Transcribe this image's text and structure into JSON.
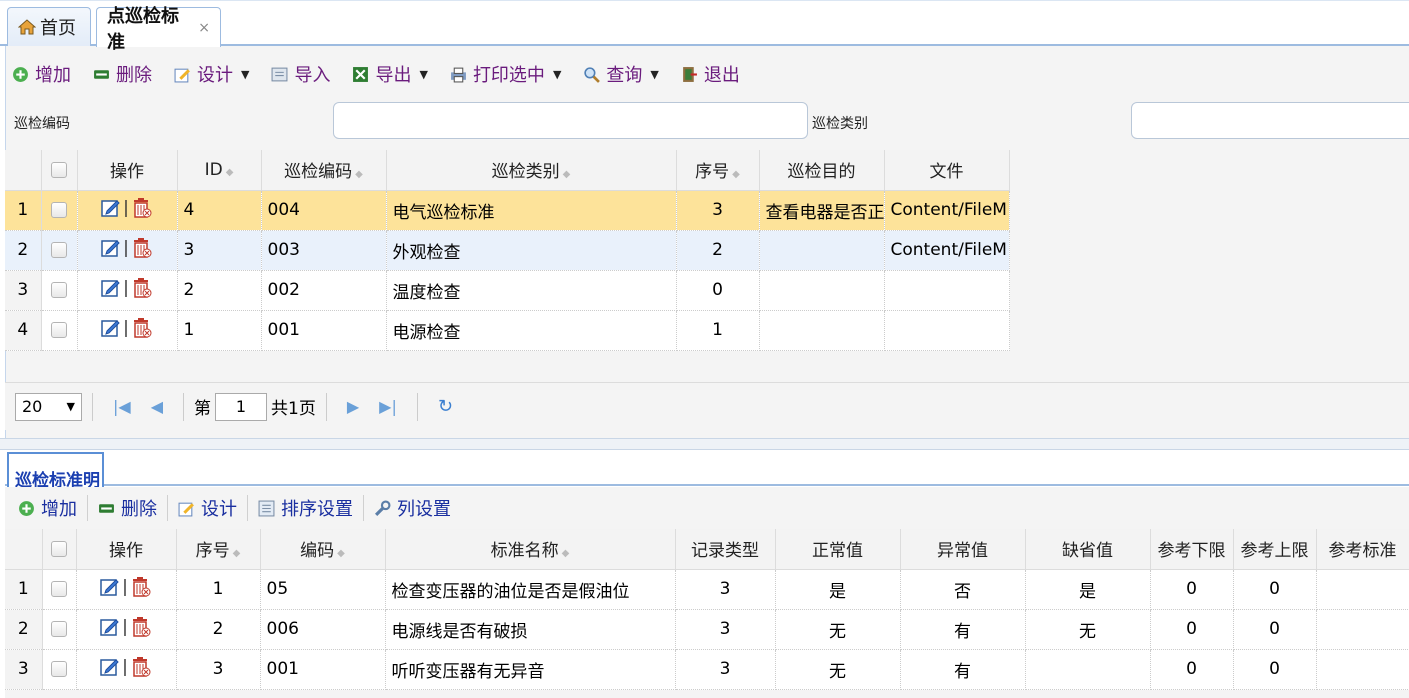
{
  "tabs": {
    "home": "首页",
    "active": "点巡检标准",
    "close": "×"
  },
  "toolbar": {
    "add": "增加",
    "delete": "删除",
    "design": "设计",
    "import": "导入",
    "export": "导出",
    "print": "打印选中",
    "query": "查询",
    "exit": "退出"
  },
  "filters": {
    "code_label": "巡检编码",
    "code_value": "",
    "type_label": "巡检类别",
    "type_value": ""
  },
  "grid1": {
    "headers": [
      "操作",
      "ID",
      "巡检编码",
      "巡检类别",
      "序号",
      "巡检目的",
      "文件"
    ],
    "rows": [
      {
        "rn": "1",
        "id": "4",
        "code": "004",
        "type": "电气巡检标准",
        "seq": "3",
        "purpose": "查看电器是否正",
        "file": "Content/FileM"
      },
      {
        "rn": "2",
        "id": "3",
        "code": "003",
        "type": "外观检查",
        "seq": "2",
        "purpose": "",
        "file": "Content/FileM"
      },
      {
        "rn": "3",
        "id": "2",
        "code": "002",
        "type": "温度检查",
        "seq": "0",
        "purpose": "",
        "file": ""
      },
      {
        "rn": "4",
        "id": "1",
        "code": "001",
        "type": "电源检查",
        "seq": "1",
        "purpose": "",
        "file": ""
      }
    ]
  },
  "pager": {
    "page_size": "20",
    "page_prefix": "第",
    "page_value": "1",
    "page_total": "共1页"
  },
  "detail": {
    "tab": "巡检标准明",
    "toolbar": {
      "add": "增加",
      "delete": "删除",
      "design": "设计",
      "sort": "排序设置",
      "columns": "列设置"
    },
    "headers": [
      "操作",
      "序号",
      "编码",
      "标准名称",
      "记录类型",
      "正常值",
      "异常值",
      "缺省值",
      "参考下限",
      "参考上限",
      "参考标准"
    ],
    "rows": [
      {
        "rn": "1",
        "seq": "1",
        "code": "05",
        "name": "检查变压器的油位是否是假油位",
        "rtype": "3",
        "normal": "是",
        "abnormal": "否",
        "default": "是",
        "low": "0",
        "high": "0",
        "std": ""
      },
      {
        "rn": "2",
        "seq": "2",
        "code": "006",
        "name": "电源线是否有破损",
        "rtype": "3",
        "normal": "无",
        "abnormal": "有",
        "default": "无",
        "low": "0",
        "high": "0",
        "std": ""
      },
      {
        "rn": "3",
        "seq": "3",
        "code": "001",
        "name": "听听变压器有无异音",
        "rtype": "3",
        "normal": "无",
        "abnormal": "有",
        "default": "",
        "low": "0",
        "high": "0",
        "std": ""
      }
    ]
  }
}
